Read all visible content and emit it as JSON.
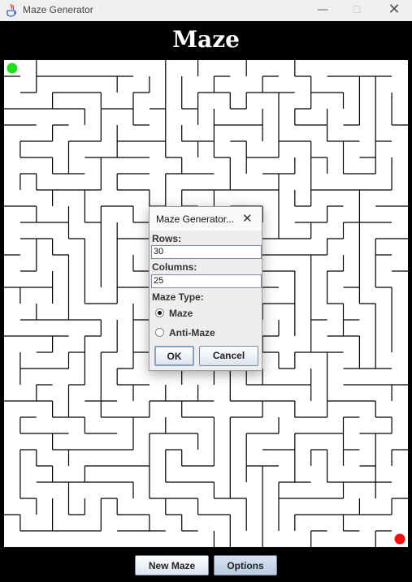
{
  "window": {
    "title": "Maze Generator",
    "minimize": "—",
    "maximize": "☐",
    "close": "✕"
  },
  "header": {
    "title": "Maze"
  },
  "maze": {
    "rows": 30,
    "columns": 25,
    "start_color": "#22dd22",
    "end_color": "#ee1111",
    "wall_color": "#000000",
    "background": "#ffffff"
  },
  "buttons": {
    "new_maze": "New Maze",
    "options": "Options"
  },
  "dialog": {
    "title": "Maze Generator...",
    "rows_label": "Rows:",
    "rows_value": "30",
    "columns_label": "Columns:",
    "columns_value": "25",
    "type_label": "Maze Type:",
    "options": [
      {
        "label": "Maze",
        "selected": true
      },
      {
        "label": "Anti-Maze",
        "selected": false
      }
    ],
    "ok": "OK",
    "cancel": "Cancel"
  }
}
